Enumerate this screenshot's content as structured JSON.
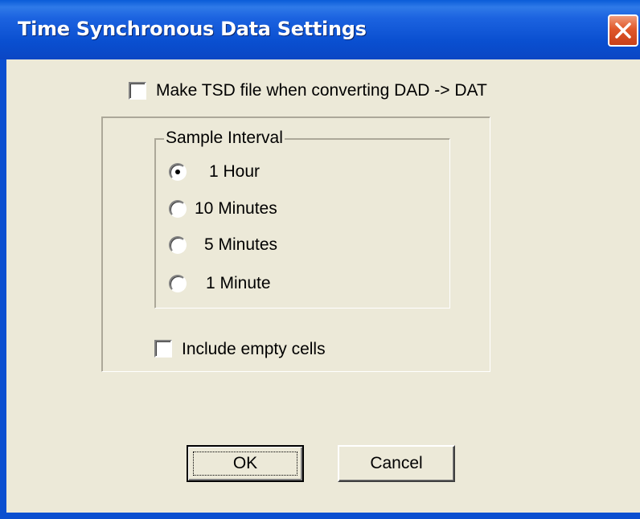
{
  "window": {
    "title": "Time Synchronous Data Settings",
    "close_icon": "close-x-icon"
  },
  "options": {
    "make_tsd_label": "Make TSD file when converting DAD -> DAT",
    "make_tsd_checked": false,
    "include_empty_label": "Include empty cells",
    "include_empty_checked": false
  },
  "sample_interval": {
    "caption": "Sample Interval",
    "selected": "1 Hour",
    "items": [
      {
        "label": "1 Hour",
        "checked": true
      },
      {
        "label": "10 Minutes",
        "checked": false
      },
      {
        "label": "5 Minutes",
        "checked": false
      },
      {
        "label": "1 Minute",
        "checked": false
      }
    ]
  },
  "buttons": {
    "ok_label": "OK",
    "cancel_label": "Cancel"
  },
  "colors": {
    "titlebar": "#0b4fd0",
    "dialog_bg": "#ece9d8",
    "close_button": "#e0582a"
  }
}
